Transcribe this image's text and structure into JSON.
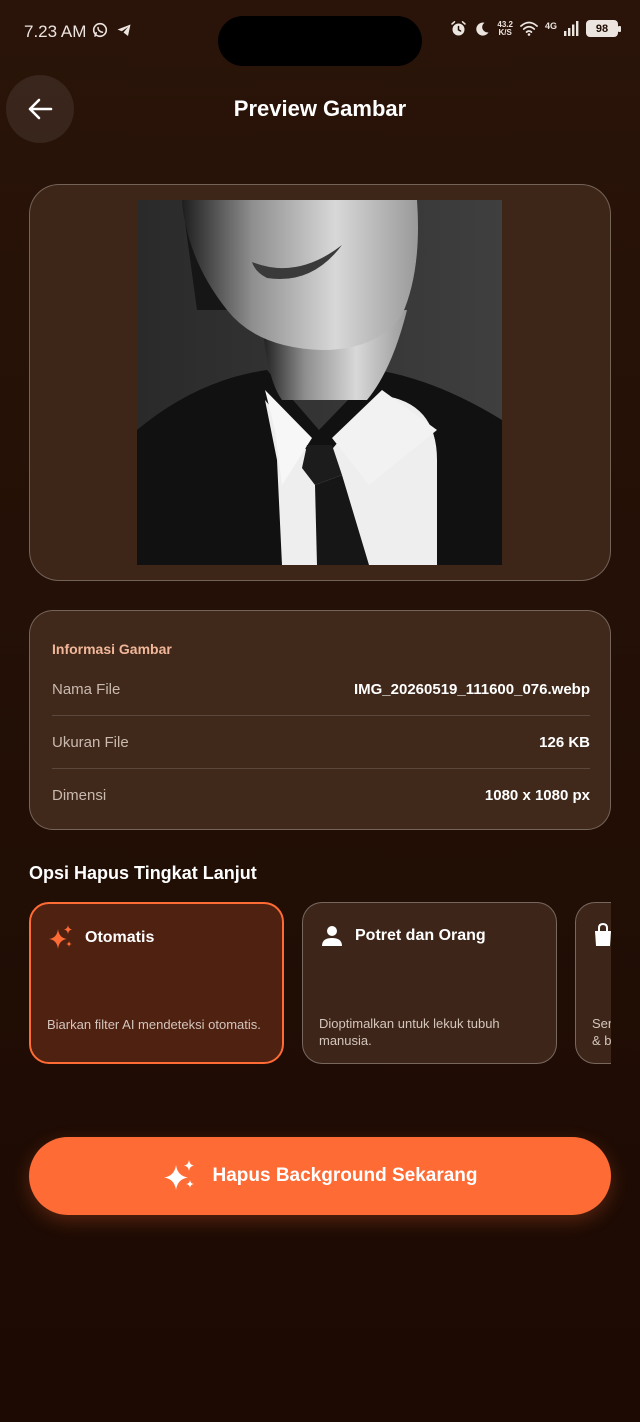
{
  "status_bar": {
    "time": "7.23 AM",
    "net_speed_value": "43.2",
    "net_speed_unit": "K/S",
    "net_type": "4G",
    "battery": "98"
  },
  "header": {
    "title": "Preview Gambar"
  },
  "info": {
    "heading": "Informasi Gambar",
    "rows": [
      {
        "label": "Nama File",
        "value": "IMG_20260519_111600_076.webp"
      },
      {
        "label": "Ukuran File",
        "value": "126 KB"
      },
      {
        "label": "Dimensi",
        "value": "1080 x 1080 px"
      }
    ]
  },
  "options": {
    "section_title": "Opsi Hapus Tingkat Lanjut",
    "items": [
      {
        "title": "Otomatis",
        "description": "Biarkan filter AI mendeteksi otomatis.",
        "icon": "sparkle-icon",
        "selected": true
      },
      {
        "title": "Potret dan Orang",
        "description": "Dioptimalkan untuk lekuk tubuh manusia.",
        "icon": "person-icon",
        "selected": false
      },
      {
        "title": "",
        "description": "Ser & b",
        "icon": "shopping-bag-icon",
        "selected": false
      }
    ]
  },
  "cta": {
    "label": "Hapus Background Sekarang"
  },
  "colors": {
    "accent": "#ff6b35",
    "background": "#1f0c04",
    "card": "#3d2618"
  }
}
